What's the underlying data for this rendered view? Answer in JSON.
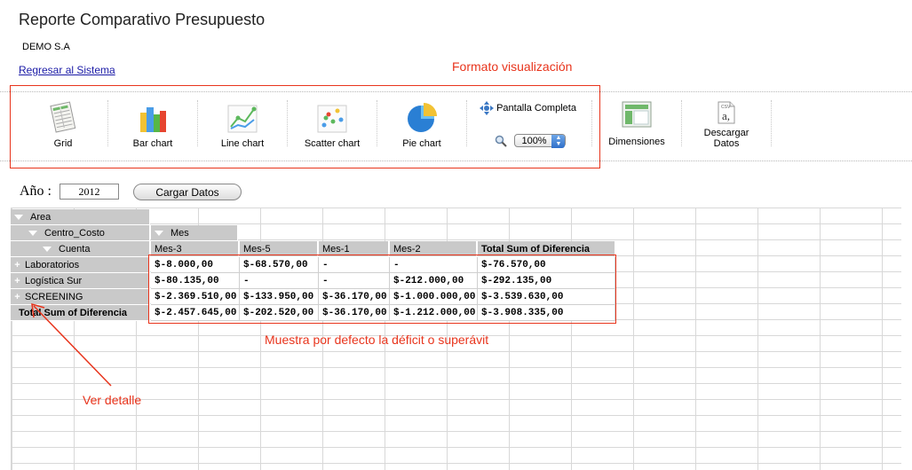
{
  "header": {
    "title": "Reporte Comparativo Presupuesto",
    "company": "DEMO S.A",
    "back_link": "Regresar al Sistema"
  },
  "annotations": {
    "format": "Formato visualización",
    "default_note": "Muestra por defecto la déficit o superávit",
    "detail": "Ver detalle"
  },
  "toolbar": {
    "grid": "Grid",
    "bar": "Bar chart",
    "line": "Line chart",
    "scatter": "Scatter chart",
    "pie": "Pie chart",
    "fullscreen": "Pantalla Completa",
    "zoom": "100%",
    "dimensions": "Dimensiones",
    "download_1": "Descargar",
    "download_2": "Datos"
  },
  "controls": {
    "year_label": "Año :",
    "year_value": "2012",
    "load_button": "Cargar Datos"
  },
  "pivot": {
    "row_dims": [
      "Area",
      "Centro_Costo",
      "Cuenta"
    ],
    "col_dim": "Mes",
    "columns": [
      "Mes-3",
      "Mes-5",
      "Mes-1",
      "Mes-2",
      "Total Sum of Diferencia"
    ],
    "rows": [
      {
        "label": "Laboratorios",
        "values": [
          "$-8.000,00",
          "$-68.570,00",
          "-",
          "-",
          "$-76.570,00"
        ]
      },
      {
        "label": "Logística Sur",
        "values": [
          "$-80.135,00",
          "-",
          "-",
          "$-212.000,00",
          "$-292.135,00"
        ]
      },
      {
        "label": "SCREENING",
        "values": [
          "$-2.369.510,00",
          "$-133.950,00",
          "$-36.170,00",
          "$-1.000.000,00",
          "$-3.539.630,00"
        ]
      }
    ],
    "total": {
      "label": "Total Sum of Diferencia",
      "values": [
        "$-2.457.645,00",
        "$-202.520,00",
        "$-36.170,00",
        "$-1.212.000,00",
        "$-3.908.335,00"
      ]
    }
  },
  "colors": {
    "annotation": "#e8341c",
    "header_bg": "#c9c9c9",
    "link": "#1a1aa6"
  }
}
